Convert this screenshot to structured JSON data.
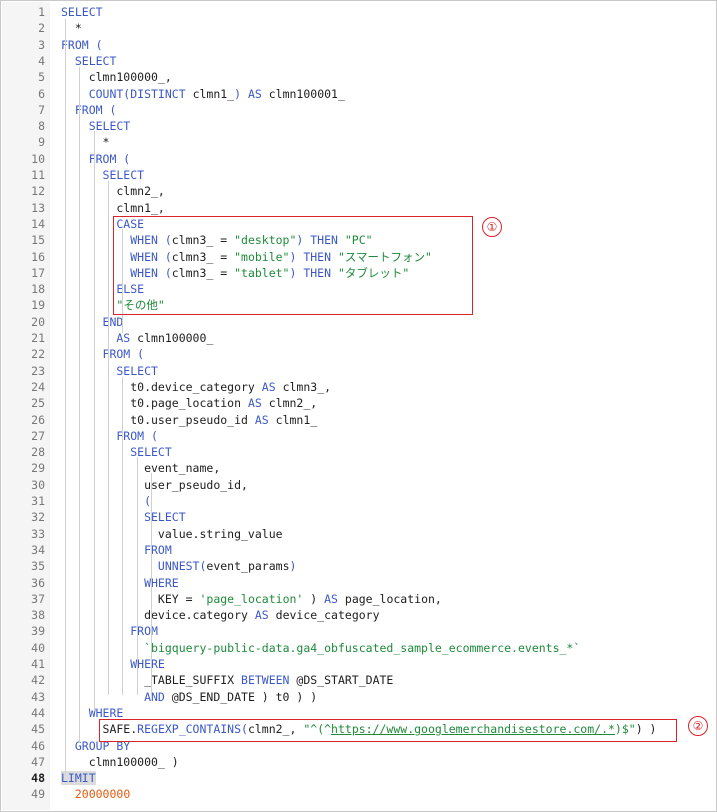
{
  "editor": {
    "markers": {
      "one": "①",
      "two": "②"
    },
    "lines": [
      {
        "n": "1",
        "tokens": [
          {
            "t": "SELECT",
            "c": "kw"
          }
        ]
      },
      {
        "n": "2",
        "tokens": [
          {
            "t": "  *",
            "c": ""
          }
        ]
      },
      {
        "n": "3",
        "tokens": [
          {
            "t": "FROM (",
            "c": "kw"
          }
        ]
      },
      {
        "n": "4",
        "tokens": [
          {
            "t": "  SELECT",
            "c": "kw"
          }
        ]
      },
      {
        "n": "5",
        "tokens": [
          {
            "t": "    clmn100000_,",
            "c": ""
          }
        ]
      },
      {
        "n": "6",
        "tokens": [
          {
            "t": "    COUNT(DISTINCT ",
            "c": "kw"
          },
          {
            "t": "clmn1_",
            "c": ""
          },
          {
            "t": ") AS ",
            "c": "kw"
          },
          {
            "t": "clmn100001_",
            "c": ""
          }
        ]
      },
      {
        "n": "7",
        "tokens": [
          {
            "t": "  FROM (",
            "c": "kw"
          }
        ]
      },
      {
        "n": "8",
        "tokens": [
          {
            "t": "    SELECT",
            "c": "kw"
          }
        ]
      },
      {
        "n": "9",
        "tokens": [
          {
            "t": "      *",
            "c": ""
          }
        ]
      },
      {
        "n": "10",
        "tokens": [
          {
            "t": "    FROM (",
            "c": "kw"
          }
        ]
      },
      {
        "n": "11",
        "tokens": [
          {
            "t": "      SELECT",
            "c": "kw"
          }
        ]
      },
      {
        "n": "12",
        "tokens": [
          {
            "t": "        clmn2_,",
            "c": ""
          }
        ]
      },
      {
        "n": "13",
        "tokens": [
          {
            "t": "        clmn1_,",
            "c": ""
          }
        ]
      },
      {
        "n": "14",
        "tokens": [
          {
            "t": "        CASE",
            "c": "kw"
          }
        ]
      },
      {
        "n": "15",
        "tokens": [
          {
            "t": "          WHEN (",
            "c": "kw"
          },
          {
            "t": "clmn3_ = ",
            "c": ""
          },
          {
            "t": "\"desktop\"",
            "c": "str"
          },
          {
            "t": ") THEN ",
            "c": "kw"
          },
          {
            "t": "\"PC\"",
            "c": "str"
          }
        ]
      },
      {
        "n": "16",
        "tokens": [
          {
            "t": "          WHEN (",
            "c": "kw"
          },
          {
            "t": "clmn3_ = ",
            "c": ""
          },
          {
            "t": "\"mobile\"",
            "c": "str"
          },
          {
            "t": ") THEN ",
            "c": "kw"
          },
          {
            "t": "\"スマートフォン\"",
            "c": "str"
          }
        ]
      },
      {
        "n": "17",
        "tokens": [
          {
            "t": "          WHEN (",
            "c": "kw"
          },
          {
            "t": "clmn3_ = ",
            "c": ""
          },
          {
            "t": "\"tablet\"",
            "c": "str"
          },
          {
            "t": ") THEN ",
            "c": "kw"
          },
          {
            "t": "\"タブレット\"",
            "c": "str"
          }
        ]
      },
      {
        "n": "18",
        "tokens": [
          {
            "t": "        ELSE",
            "c": "kw"
          }
        ]
      },
      {
        "n": "19",
        "tokens": [
          {
            "t": "        ",
            "c": ""
          },
          {
            "t": "\"その他\"",
            "c": "str"
          }
        ]
      },
      {
        "n": "20",
        "tokens": [
          {
            "t": "      END",
            "c": "kw"
          }
        ]
      },
      {
        "n": "21",
        "tokens": [
          {
            "t": "        AS ",
            "c": "kw"
          },
          {
            "t": "clmn100000_",
            "c": ""
          }
        ]
      },
      {
        "n": "22",
        "tokens": [
          {
            "t": "      FROM (",
            "c": "kw"
          }
        ]
      },
      {
        "n": "23",
        "tokens": [
          {
            "t": "        SELECT",
            "c": "kw"
          }
        ]
      },
      {
        "n": "24",
        "tokens": [
          {
            "t": "          t0.device_category ",
            "c": ""
          },
          {
            "t": "AS ",
            "c": "kw"
          },
          {
            "t": "clmn3_,",
            "c": ""
          }
        ]
      },
      {
        "n": "25",
        "tokens": [
          {
            "t": "          t0.page_location ",
            "c": ""
          },
          {
            "t": "AS ",
            "c": "kw"
          },
          {
            "t": "clmn2_,",
            "c": ""
          }
        ]
      },
      {
        "n": "26",
        "tokens": [
          {
            "t": "          t0.user_pseudo_id ",
            "c": ""
          },
          {
            "t": "AS ",
            "c": "kw"
          },
          {
            "t": "clmn1_",
            "c": ""
          }
        ]
      },
      {
        "n": "27",
        "tokens": [
          {
            "t": "        FROM (",
            "c": "kw"
          }
        ]
      },
      {
        "n": "28",
        "tokens": [
          {
            "t": "          SELECT",
            "c": "kw"
          }
        ]
      },
      {
        "n": "29",
        "tokens": [
          {
            "t": "            event_name,",
            "c": ""
          }
        ]
      },
      {
        "n": "30",
        "tokens": [
          {
            "t": "            user_pseudo_id,",
            "c": ""
          }
        ]
      },
      {
        "n": "31",
        "tokens": [
          {
            "t": "            (",
            "c": "kw"
          }
        ]
      },
      {
        "n": "32",
        "tokens": [
          {
            "t": "            SELECT",
            "c": "kw"
          }
        ]
      },
      {
        "n": "33",
        "tokens": [
          {
            "t": "              value.string_value",
            "c": ""
          }
        ]
      },
      {
        "n": "34",
        "tokens": [
          {
            "t": "            FROM",
            "c": "kw"
          }
        ]
      },
      {
        "n": "35",
        "tokens": [
          {
            "t": "              UNNEST(",
            "c": "kw"
          },
          {
            "t": "event_params",
            "c": ""
          },
          {
            "t": ")",
            "c": "kw"
          }
        ]
      },
      {
        "n": "36",
        "tokens": [
          {
            "t": "            WHERE",
            "c": "kw"
          }
        ]
      },
      {
        "n": "37",
        "tokens": [
          {
            "t": "              KEY = ",
            "c": ""
          },
          {
            "t": "'page_location'",
            "c": "str"
          },
          {
            "t": " ) ",
            "c": ""
          },
          {
            "t": "AS ",
            "c": "kw"
          },
          {
            "t": "page_location,",
            "c": ""
          }
        ]
      },
      {
        "n": "38",
        "tokens": [
          {
            "t": "            device.category ",
            "c": ""
          },
          {
            "t": "AS ",
            "c": "kw"
          },
          {
            "t": "device_category",
            "c": ""
          }
        ]
      },
      {
        "n": "39",
        "tokens": [
          {
            "t": "          FROM",
            "c": "kw"
          }
        ]
      },
      {
        "n": "40",
        "tokens": [
          {
            "t": "            ",
            "c": ""
          },
          {
            "t": "`bigquery-public-data.ga4_obfuscated_sample_ecommerce.events_*`",
            "c": "str"
          }
        ]
      },
      {
        "n": "41",
        "tokens": [
          {
            "t": "          WHERE",
            "c": "kw"
          }
        ]
      },
      {
        "n": "42",
        "tokens": [
          {
            "t": "            _TABLE_SUFFIX ",
            "c": ""
          },
          {
            "t": "BETWEEN ",
            "c": "kw"
          },
          {
            "t": "@DS_START_DATE",
            "c": ""
          }
        ]
      },
      {
        "n": "43",
        "tokens": [
          {
            "t": "            AND ",
            "c": "kw"
          },
          {
            "t": "@DS_END_DATE ) t0 ) )",
            "c": ""
          }
        ]
      },
      {
        "n": "44",
        "tokens": [
          {
            "t": "    WHERE",
            "c": "kw"
          }
        ]
      },
      {
        "n": "45",
        "tokens": [
          {
            "t": "      SAFE.",
            "c": ""
          },
          {
            "t": "REGEXP_CONTAINS(",
            "c": "kw"
          },
          {
            "t": "clmn2_, ",
            "c": ""
          },
          {
            "t": "\"^(^",
            "c": "str"
          },
          {
            "t": "https://www.googlemerchandisestore.com/.*",
            "c": "url"
          },
          {
            "t": ")$\"",
            "c": "str"
          },
          {
            "t": ") )",
            "c": ""
          }
        ]
      },
      {
        "n": "46",
        "tokens": [
          {
            "t": "  GROUP BY",
            "c": "kw"
          }
        ]
      },
      {
        "n": "47",
        "tokens": [
          {
            "t": "    clmn100000_ )",
            "c": ""
          }
        ]
      },
      {
        "n": "48",
        "tokens": [
          {
            "t": "LIMIT",
            "c": "kw hl"
          }
        ],
        "active": true
      },
      {
        "n": "49",
        "tokens": [
          {
            "t": "  ",
            "c": ""
          },
          {
            "t": "20000000",
            "c": "num"
          }
        ]
      }
    ]
  }
}
